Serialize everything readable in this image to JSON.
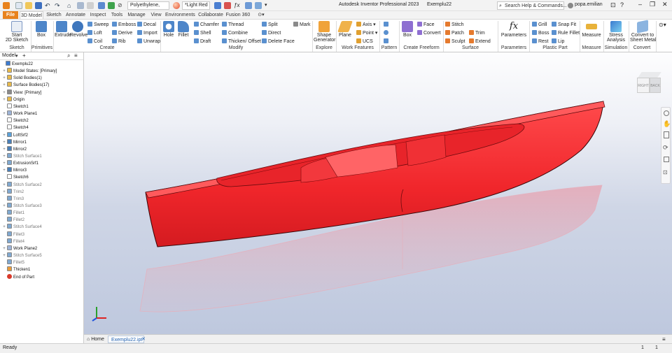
{
  "title_bar": {
    "material": "Polyethylene,",
    "appearance": "*Light Red",
    "app_title": "Autodesk Inventor Professional 2023",
    "document": "Exemplu22",
    "search_placeholder": "Search Help & Commands...",
    "user": "popa.emilian"
  },
  "tabs": [
    "File",
    "3D Model",
    "Sketch",
    "Annotate",
    "Inspect",
    "Tools",
    "Manage",
    "View",
    "Environments",
    "Collaborate",
    "Fusion 360"
  ],
  "ribbon": {
    "sketch": {
      "start": "Start",
      "sketch2d": "2D Sketch",
      "group": "Sketch"
    },
    "primitives": {
      "box": "Box",
      "group": "Primitives"
    },
    "create": {
      "extrude": "Extrude",
      "revolve": "Revolve",
      "sweep": "Sweep",
      "loft": "Loft",
      "coil": "Coil",
      "emboss": "Emboss",
      "derive": "Derive",
      "rib": "Rib",
      "decal": "Decal",
      "import": "Import",
      "unwrap": "Unwrap",
      "group": "Create"
    },
    "modify": {
      "hole": "Hole",
      "fillet": "Fillet",
      "chamfer": "Chamfer",
      "shell": "Shell",
      "draft": "Draft",
      "thread": "Thread",
      "combine": "Combine",
      "thicken": "Thicken/ Offset",
      "split": "Split",
      "direct": "Direct",
      "delete_face": "Delete Face",
      "mark": "Mark",
      "group": "Modify"
    },
    "explore": {
      "shape_gen_1": "Shape",
      "shape_gen_2": "Generator",
      "group": "Explore"
    },
    "work_features": {
      "plane": "Plane",
      "axis": "Axis",
      "point": "Point",
      "ucs": "UCS",
      "group": "Work Features"
    },
    "pattern": {
      "group": "Pattern"
    },
    "freeform": {
      "box": "Box",
      "face": "Face",
      "convert": "Convert",
      "group": "Create Freeform"
    },
    "surface": {
      "stitch": "Stitch",
      "patch": "Patch",
      "sculpt": "Sculpt",
      "trim": "Trim",
      "extend": "Extend",
      "group": "Surface"
    },
    "parameters": {
      "label": "Parameters",
      "group": "Parameters"
    },
    "plastic": {
      "grill": "Grill",
      "boss": "Boss",
      "rest": "Rest",
      "snap_fit": "Snap Fit",
      "rule_fillet": "Rule Fillet",
      "lip": "Lip",
      "group": "Plastic Part"
    },
    "measure": {
      "label": "Measure",
      "group": "Measure"
    },
    "simulation": {
      "l1": "Stress",
      "l2": "Analysis",
      "group": "Simulation"
    },
    "convert": {
      "l1": "Convert to",
      "l2": "Sheet Metal",
      "group": "Convert"
    }
  },
  "browser": {
    "tab": "Model",
    "items": [
      {
        "label": "Exemplu22",
        "icon": "part-icon",
        "color": "#3b7bd0",
        "level": 0,
        "exp": false,
        "dim": false
      },
      {
        "label": "Model States: [Primary]",
        "icon": "folder-icon",
        "color": "#e7b94a",
        "level": 1,
        "exp": true,
        "dim": false
      },
      {
        "label": "Solid Bodies(1)",
        "icon": "folder-icon",
        "color": "#e7b94a",
        "level": 1,
        "exp": true,
        "dim": false
      },
      {
        "label": "Surface Bodies(17)",
        "icon": "folder-icon",
        "color": "#e7b94a",
        "level": 1,
        "exp": true,
        "dim": false
      },
      {
        "label": "View: [Primary]",
        "icon": "view-icon",
        "color": "#8a8a8a",
        "level": 1,
        "exp": true,
        "dim": false
      },
      {
        "label": "Origin",
        "icon": "folder-icon",
        "color": "#e7b94a",
        "level": 1,
        "exp": true,
        "dim": false
      },
      {
        "label": "Sketch1",
        "icon": "sketch-icon",
        "color": "#ffffff",
        "level": 1,
        "exp": false,
        "dim": false
      },
      {
        "label": "Work Plane1",
        "icon": "workplane-icon",
        "color": "#9db3d6",
        "level": 1,
        "exp": true,
        "dim": false
      },
      {
        "label": "Sketch2",
        "icon": "sketch-icon",
        "color": "#ffffff",
        "level": 1,
        "exp": false,
        "dim": false
      },
      {
        "label": "Sketch4",
        "icon": "sketch-icon",
        "color": "#ffffff",
        "level": 1,
        "exp": false,
        "dim": false
      },
      {
        "label": "LoftSrf2",
        "icon": "loft-icon",
        "color": "#5aa0d8",
        "level": 1,
        "exp": true,
        "dim": false
      },
      {
        "label": "Mirror1",
        "icon": "mirror-icon",
        "color": "#4a7fb8",
        "level": 1,
        "exp": true,
        "dim": false
      },
      {
        "label": "Mirror2",
        "icon": "mirror-icon",
        "color": "#4a7fb8",
        "level": 1,
        "exp": true,
        "dim": false
      },
      {
        "label": "Stitch Surface1",
        "icon": "stitch-icon",
        "color": "#7fa8d0",
        "level": 1,
        "exp": true,
        "dim": true
      },
      {
        "label": "ExtrusionSrf1",
        "icon": "extrusion-icon",
        "color": "#7fa8d0",
        "level": 1,
        "exp": true,
        "dim": false
      },
      {
        "label": "Mirror3",
        "icon": "mirror-icon",
        "color": "#4a7fb8",
        "level": 1,
        "exp": true,
        "dim": false
      },
      {
        "label": "Sketch6",
        "icon": "sketch-icon",
        "color": "#ffffff",
        "level": 1,
        "exp": false,
        "dim": false
      },
      {
        "label": "Stitch Surface2",
        "icon": "stitch-icon",
        "color": "#7fa8d0",
        "level": 1,
        "exp": true,
        "dim": true
      },
      {
        "label": "Trim2",
        "icon": "trim-icon",
        "color": "#7fa8d0",
        "level": 1,
        "exp": true,
        "dim": true
      },
      {
        "label": "Trim3",
        "icon": "trim-icon",
        "color": "#7fa8d0",
        "level": 1,
        "exp": false,
        "dim": true
      },
      {
        "label": "Stitch Surface3",
        "icon": "stitch-icon",
        "color": "#7fa8d0",
        "level": 1,
        "exp": true,
        "dim": true
      },
      {
        "label": "Fillet1",
        "icon": "fillet-icon",
        "color": "#7fa8d0",
        "level": 1,
        "exp": false,
        "dim": true
      },
      {
        "label": "Fillet2",
        "icon": "fillet-icon",
        "color": "#7fa8d0",
        "level": 1,
        "exp": false,
        "dim": true
      },
      {
        "label": "Stitch Surface4",
        "icon": "stitch-icon",
        "color": "#7fa8d0",
        "level": 1,
        "exp": true,
        "dim": true
      },
      {
        "label": "Fillet3",
        "icon": "fillet-icon",
        "color": "#7fa8d0",
        "level": 1,
        "exp": false,
        "dim": true
      },
      {
        "label": "Fillet4",
        "icon": "fillet-icon",
        "color": "#7fa8d0",
        "level": 1,
        "exp": false,
        "dim": true
      },
      {
        "label": "Work Plane2",
        "icon": "workplane-icon",
        "color": "#9db3d6",
        "level": 1,
        "exp": true,
        "dim": false
      },
      {
        "label": "Stitch Surface5",
        "icon": "stitch-icon",
        "color": "#7fa8d0",
        "level": 1,
        "exp": true,
        "dim": true
      },
      {
        "label": "Fillet5",
        "icon": "fillet-icon",
        "color": "#7fa8d0",
        "level": 1,
        "exp": false,
        "dim": true
      },
      {
        "label": "Thicken1",
        "icon": "thicken-icon",
        "color": "#e89b3a",
        "level": 1,
        "exp": false,
        "dim": false
      },
      {
        "label": "End of Part",
        "icon": "end-of-part-icon",
        "color": "#d93a2b",
        "level": 1,
        "exp": false,
        "dim": false
      }
    ]
  },
  "viewcube": {
    "front": "RIGHT",
    "side": "BACK"
  },
  "doc_tabs": {
    "home": "Home",
    "active": "Exemplu22.ipt"
  },
  "status": {
    "text": "Ready",
    "count_a": "1",
    "count_b": "1"
  },
  "colors": {
    "accent": "#e8821d",
    "model": "#f0262b",
    "model_edge": "#8a0c0f"
  }
}
